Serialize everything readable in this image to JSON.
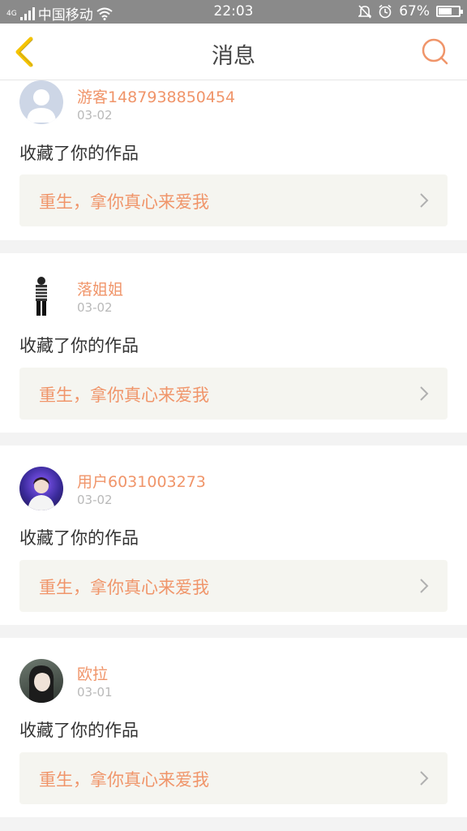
{
  "status": {
    "carrier": "中国移动",
    "time": "22:03",
    "battery": "67%",
    "battery_level": 0.67,
    "signal_prefix": "4G"
  },
  "header": {
    "title": "消息",
    "back_icon": "chevron-left-icon",
    "search_icon": "search-icon",
    "accent": "#f0956a",
    "back_color": "#f5c400"
  },
  "messages": [
    {
      "user": "游客1487938850454",
      "date": "03-02",
      "action": "收藏了你的作品",
      "work": "重生，拿你真心来爱我",
      "avatar": "default-avatar"
    },
    {
      "user": "落姐姐",
      "date": "03-02",
      "action": "收藏了你的作品",
      "work": "重生，拿你真心来爱我",
      "avatar": "figure-avatar"
    },
    {
      "user": "用户6031003273",
      "date": "03-02",
      "action": "收藏了你的作品",
      "work": "重生，拿你真心来爱我",
      "avatar": "photo-avatar"
    },
    {
      "user": "欧拉",
      "date": "03-01",
      "action": "收藏了你的作品",
      "work": "重生，拿你真心来爱我",
      "avatar": "photo-avatar"
    }
  ]
}
